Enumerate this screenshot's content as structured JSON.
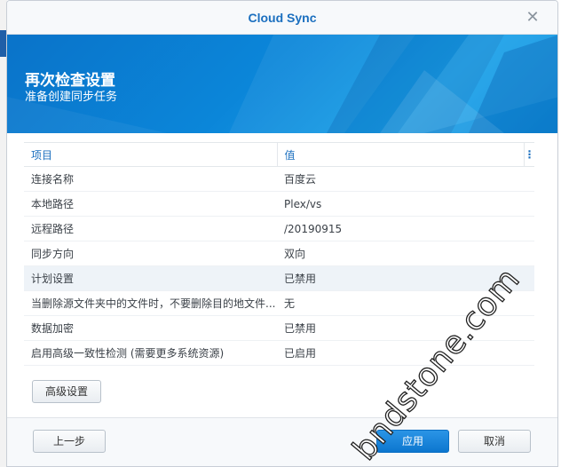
{
  "window": {
    "title": "Cloud Sync"
  },
  "banner": {
    "title": "再次检查设置",
    "subtitle": "准备创建同步任务"
  },
  "table": {
    "headers": {
      "item": "项目",
      "value": "值"
    },
    "rows": [
      {
        "item": "连接名称",
        "value": "百度云"
      },
      {
        "item": "本地路径",
        "value": "Plex/vs"
      },
      {
        "item": "远程路径",
        "value": "/20190915"
      },
      {
        "item": "同步方向",
        "value": "双向"
      },
      {
        "item": "计划设置",
        "value": "已禁用"
      },
      {
        "item": "当删除源文件夹中的文件时，不要删除目的地文件...",
        "value": "无"
      },
      {
        "item": "数据加密",
        "value": "已禁用"
      },
      {
        "item": "启用高级一致性检测 (需要更多系统资源)",
        "value": "已启用"
      }
    ]
  },
  "buttons": {
    "advanced": "高级设置",
    "back": "上一步",
    "apply": "应用",
    "cancel": "取消"
  },
  "watermark": "bndstone.com",
  "colors": {
    "accent": "#1b6fbf",
    "banner": "#0b86d9",
    "primary_button": "#0c76cf"
  },
  "icons": {
    "close": "close-icon",
    "column_menu": "column-menu-icon"
  }
}
